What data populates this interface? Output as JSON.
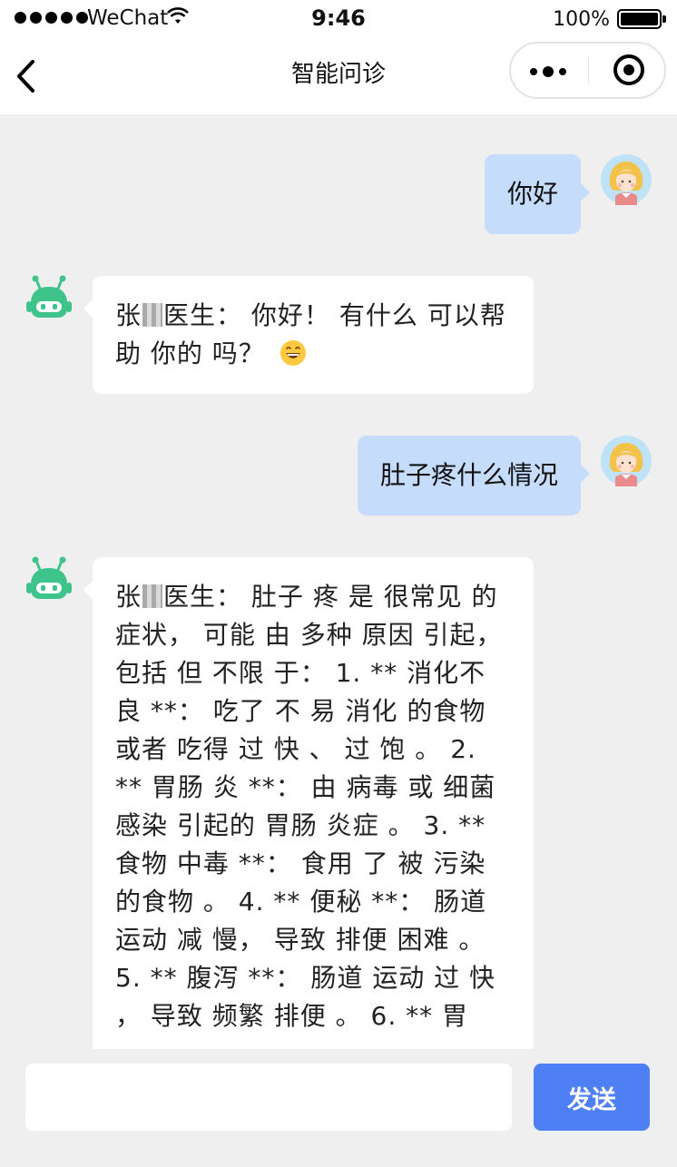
{
  "status_bar": {
    "carrier": "WeChat",
    "time": "9:46",
    "battery_percent": "100%"
  },
  "nav": {
    "title": "智能问诊"
  },
  "icons": {
    "back": "chevron-left-icon",
    "more": "more-dots-icon",
    "close": "target-circle-icon",
    "user_avatar": "girl-avatar-icon",
    "bot_avatar": "robot-icon",
    "emoji": "grinning-emoji-icon"
  },
  "colors": {
    "user_bubble": "#c6dcfb",
    "bot_bubble": "#ffffff",
    "bot_green": "#3ec48a",
    "send_button": "#4f7ff5",
    "background": "#efefef"
  },
  "messages": [
    {
      "role": "user",
      "text": "你好"
    },
    {
      "role": "bot",
      "name_prefix": "张",
      "name_suffix": "医生：",
      "text": " 你好！ 有什么 可以帮助 你的 吗？"
    },
    {
      "role": "user",
      "text": "肚子疼什么情况"
    },
    {
      "role": "bot",
      "name_prefix": "张",
      "name_suffix": "医生：",
      "text": " 肚子 疼 是 很常见 的症状， 可能 由 多种 原因 引起， 包括 但 不限 于： 1. ** 消化不良 **： 吃了 不 易 消化 的食物 或者 吃得 过 快 、 过 饱 。 2. ** 胃肠 炎 **： 由 病毒 或 细菌感染 引起的 胃肠 炎症 。 3. ** 食物 中毒 **： 食用 了 被 污染 的食物 。 4. ** 便秘 **： 肠道 运动 减 慢， 导致 排便 困难 。 5. ** 腹泻 **： 肠道 运动 过 快 ， 导致 频繁 排便 。 6. ** 胃"
    }
  ],
  "input": {
    "value": "",
    "placeholder": "",
    "send_label": "发送"
  }
}
